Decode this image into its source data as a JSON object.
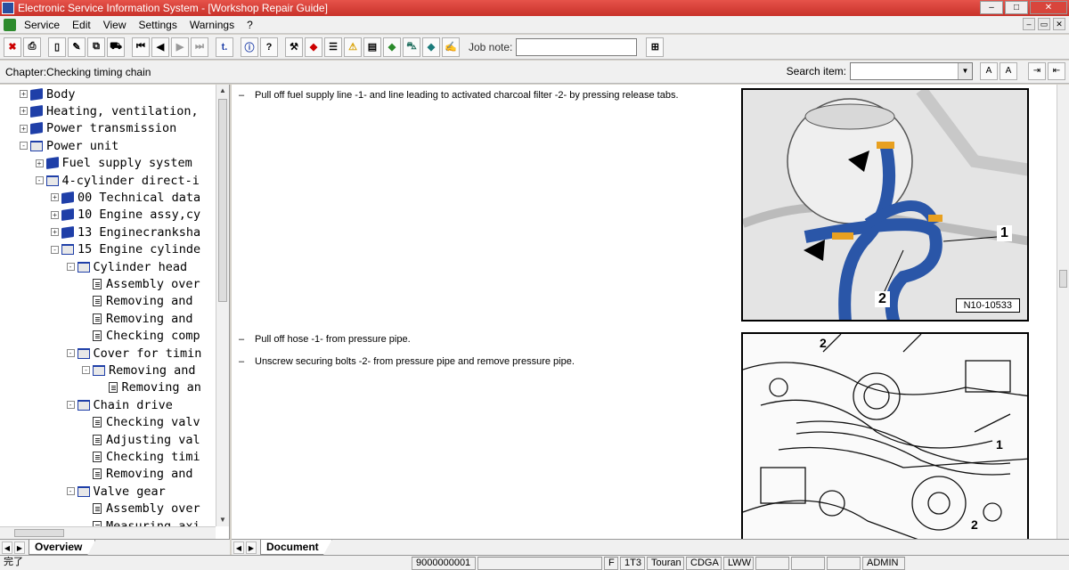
{
  "window": {
    "title": "Electronic Service Information System - [Workshop Repair Guide]"
  },
  "menu": [
    "Service",
    "Edit",
    "View",
    "Settings",
    "Warnings",
    "?"
  ],
  "toolbar": {
    "job_note_label": "Job note:"
  },
  "chapter": {
    "label": "Chapter:Checking timing chain"
  },
  "search": {
    "label": "Search item:"
  },
  "tree": [
    {
      "label": "Body",
      "level": 1,
      "icon": "closed",
      "expander": "+"
    },
    {
      "label": "Heating, ventilation,",
      "level": 1,
      "icon": "closed",
      "expander": "+"
    },
    {
      "label": "Power transmission",
      "level": 1,
      "icon": "closed",
      "expander": "+"
    },
    {
      "label": "Power unit",
      "level": 1,
      "icon": "open",
      "expander": "-"
    },
    {
      "label": "Fuel supply system",
      "level": 2,
      "icon": "closed",
      "expander": "+"
    },
    {
      "label": "4-cylinder direct-i",
      "level": 2,
      "icon": "open",
      "expander": "-"
    },
    {
      "label": "00 Technical data",
      "level": 3,
      "icon": "closed",
      "expander": "+"
    },
    {
      "label": "10 Engine assy,cy",
      "level": 3,
      "icon": "closed",
      "expander": "+"
    },
    {
      "label": "13 Enginecranksha",
      "level": 3,
      "icon": "closed",
      "expander": "+"
    },
    {
      "label": "15 Engine cylinde",
      "level": 3,
      "icon": "open",
      "expander": "-"
    },
    {
      "label": "Cylinder head",
      "level": 4,
      "icon": "open",
      "expander": "-"
    },
    {
      "label": "Assembly over",
      "level": 5,
      "icon": "doc",
      "expander": ""
    },
    {
      "label": "Removing and",
      "level": 5,
      "icon": "doc",
      "expander": ""
    },
    {
      "label": "Removing and",
      "level": 5,
      "icon": "doc",
      "expander": ""
    },
    {
      "label": "Checking comp",
      "level": 5,
      "icon": "doc",
      "expander": ""
    },
    {
      "label": "Cover for timin",
      "level": 4,
      "icon": "open",
      "expander": "-"
    },
    {
      "label": "Removing and",
      "level": 5,
      "icon": "open",
      "expander": "-"
    },
    {
      "label": "Removing an",
      "level": 6,
      "icon": "doc",
      "expander": ""
    },
    {
      "label": "Chain drive",
      "level": 4,
      "icon": "open",
      "expander": "-"
    },
    {
      "label": "Checking valv",
      "level": 5,
      "icon": "doc",
      "expander": ""
    },
    {
      "label": "Adjusting val",
      "level": 5,
      "icon": "doc",
      "expander": ""
    },
    {
      "label": "Checking timi",
      "level": 5,
      "icon": "doc",
      "expander": ""
    },
    {
      "label": "Removing and",
      "level": 5,
      "icon": "doc",
      "expander": ""
    },
    {
      "label": "Valve gear",
      "level": 4,
      "icon": "open",
      "expander": "-"
    },
    {
      "label": "Assembly over",
      "level": 5,
      "icon": "doc",
      "expander": ""
    },
    {
      "label": "Measuring axi",
      "level": 5,
      "icon": "doc",
      "expander": ""
    }
  ],
  "tabs": {
    "left": "Overview",
    "right": "Document"
  },
  "document": {
    "step1": "Pull off fuel supply line -1- and line leading to activated charcoal filter -2- by pressing release tabs.",
    "step2": "Pull off hose -1- from pressure pipe.",
    "step3": "Unscrew securing bolts -2- from pressure pipe and remove pressure pipe.",
    "dash": "–",
    "figure1": {
      "label": "N10-10533",
      "callout1": "1",
      "callout2": "2"
    },
    "figure2": {
      "callout_top": "2",
      "callout_mid": "1",
      "callout_bottom": "2"
    }
  },
  "status": {
    "left": "完了",
    "code": "9000000001",
    "f": "F",
    "model": "1T3",
    "name": "Touran",
    "engine": "CDGA",
    "gear": "LWW",
    "user": "ADMIN"
  },
  "colors": {
    "titlebar": "#c8312a",
    "book": "#1f3fa8",
    "hose": "#2a56a8"
  }
}
